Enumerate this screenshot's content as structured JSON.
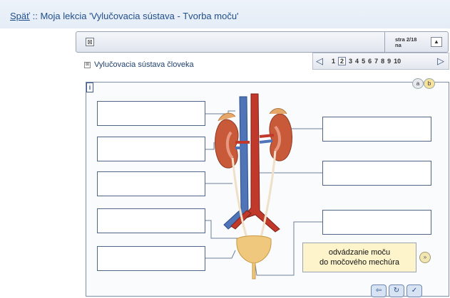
{
  "header": {
    "back_link": "Späť",
    "title_rest": " :: Moja lekcia 'Vylučovacia sústava - Tvorba moču'"
  },
  "panel": {
    "close_icon": "⊠",
    "page_label": "stra  2/18 na",
    "up_button": "▲"
  },
  "section": {
    "title": "Vylučovacia sústava človeka",
    "icon": "⊠"
  },
  "pager": {
    "prev": "◁",
    "next": "▷",
    "pages": [
      "1",
      "2",
      "3",
      "4",
      "5",
      "6",
      "7",
      "8",
      "9",
      "10"
    ],
    "current": "2"
  },
  "content": {
    "info_icon": "i",
    "btn_a": "a",
    "btn_b": "b",
    "tooltip_line1": "odvádzanie moču",
    "tooltip_line2": "do močového mechúra",
    "next_icon": "»"
  },
  "footer_icons": [
    "⇦",
    "↻",
    "✓"
  ],
  "colors": {
    "accent": "#1f4e8c",
    "box_border": "#4f6687",
    "tooltip_bg": "#fdf4cc",
    "kidney": "#c85a3a",
    "vein": "#4f75b8",
    "artery": "#c0392b",
    "bladder": "#efc77d"
  }
}
